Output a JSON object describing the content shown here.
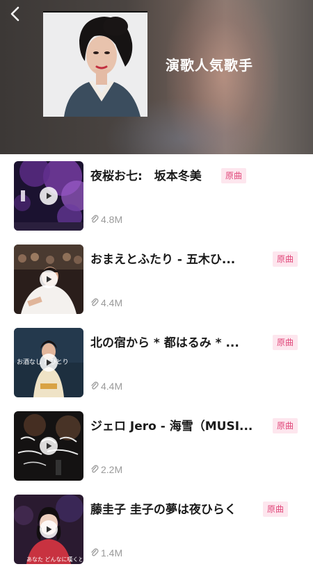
{
  "header": {
    "title": "演歌人気歌手",
    "back_icon": "chevron-left-icon"
  },
  "badge_label": "原曲",
  "items": [
    {
      "title": "夜桜お七:　坂本冬美",
      "views": "4.8M",
      "badge": true
    },
    {
      "title": "おまえとふたり - 五木ひ...",
      "views": "4.4M",
      "badge": true
    },
    {
      "title": "北の宿から * 都はるみ * ...",
      "views": "4.4M",
      "badge": true,
      "thumb_caption": "お酒なし だひとり"
    },
    {
      "title": "ジェロ Jero - 海雪（MUSI...",
      "views": "2.2M",
      "badge": true
    },
    {
      "title": "藤圭子 圭子の夢は夜ひらく",
      "views": "1.4M",
      "badge": true,
      "thumb_caption": "あなた どんなに嘆くとも"
    }
  ],
  "colors": {
    "badge_bg": "#fde6ee",
    "badge_text": "#e0487a",
    "views_text": "#9a9a9a"
  }
}
